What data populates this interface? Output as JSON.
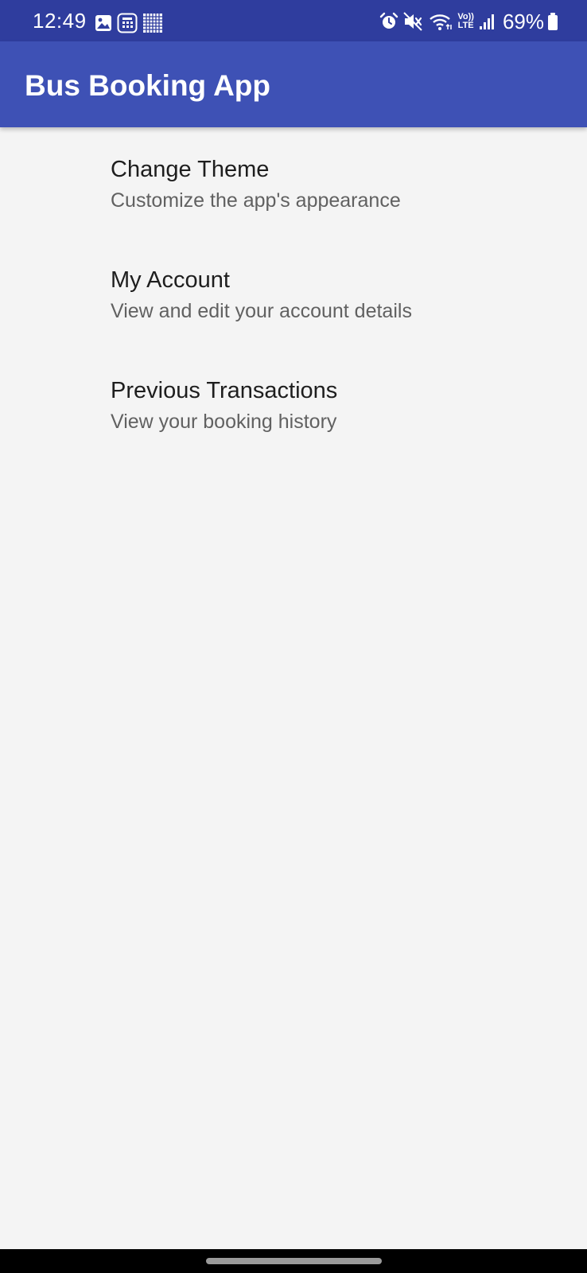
{
  "status_bar": {
    "time": "12:49",
    "left_icons": [
      "image-notification-icon",
      "calculator-notification-icon",
      "grid-notification-icon"
    ],
    "right_icons": [
      "alarm-icon",
      "mute-icon",
      "wifi-icon",
      "volte-lte-icon",
      "signal-icon"
    ],
    "volte_top": "Vo))",
    "volte_bottom": "LTE",
    "battery_percent": "69%"
  },
  "app_bar": {
    "title": "Bus Booking App"
  },
  "menu": {
    "items": [
      {
        "title": "Change Theme",
        "subtitle": "Customize the app's appearance"
      },
      {
        "title": "My Account",
        "subtitle": "View and edit your account details"
      },
      {
        "title": "Previous Transactions",
        "subtitle": "View your booking history"
      }
    ]
  },
  "colors": {
    "status_bar": "#2f3d9e",
    "app_bar": "#3e51b5",
    "background": "#f4f4f4",
    "title_text": "#1e1e1e",
    "subtitle_text": "#616161"
  }
}
